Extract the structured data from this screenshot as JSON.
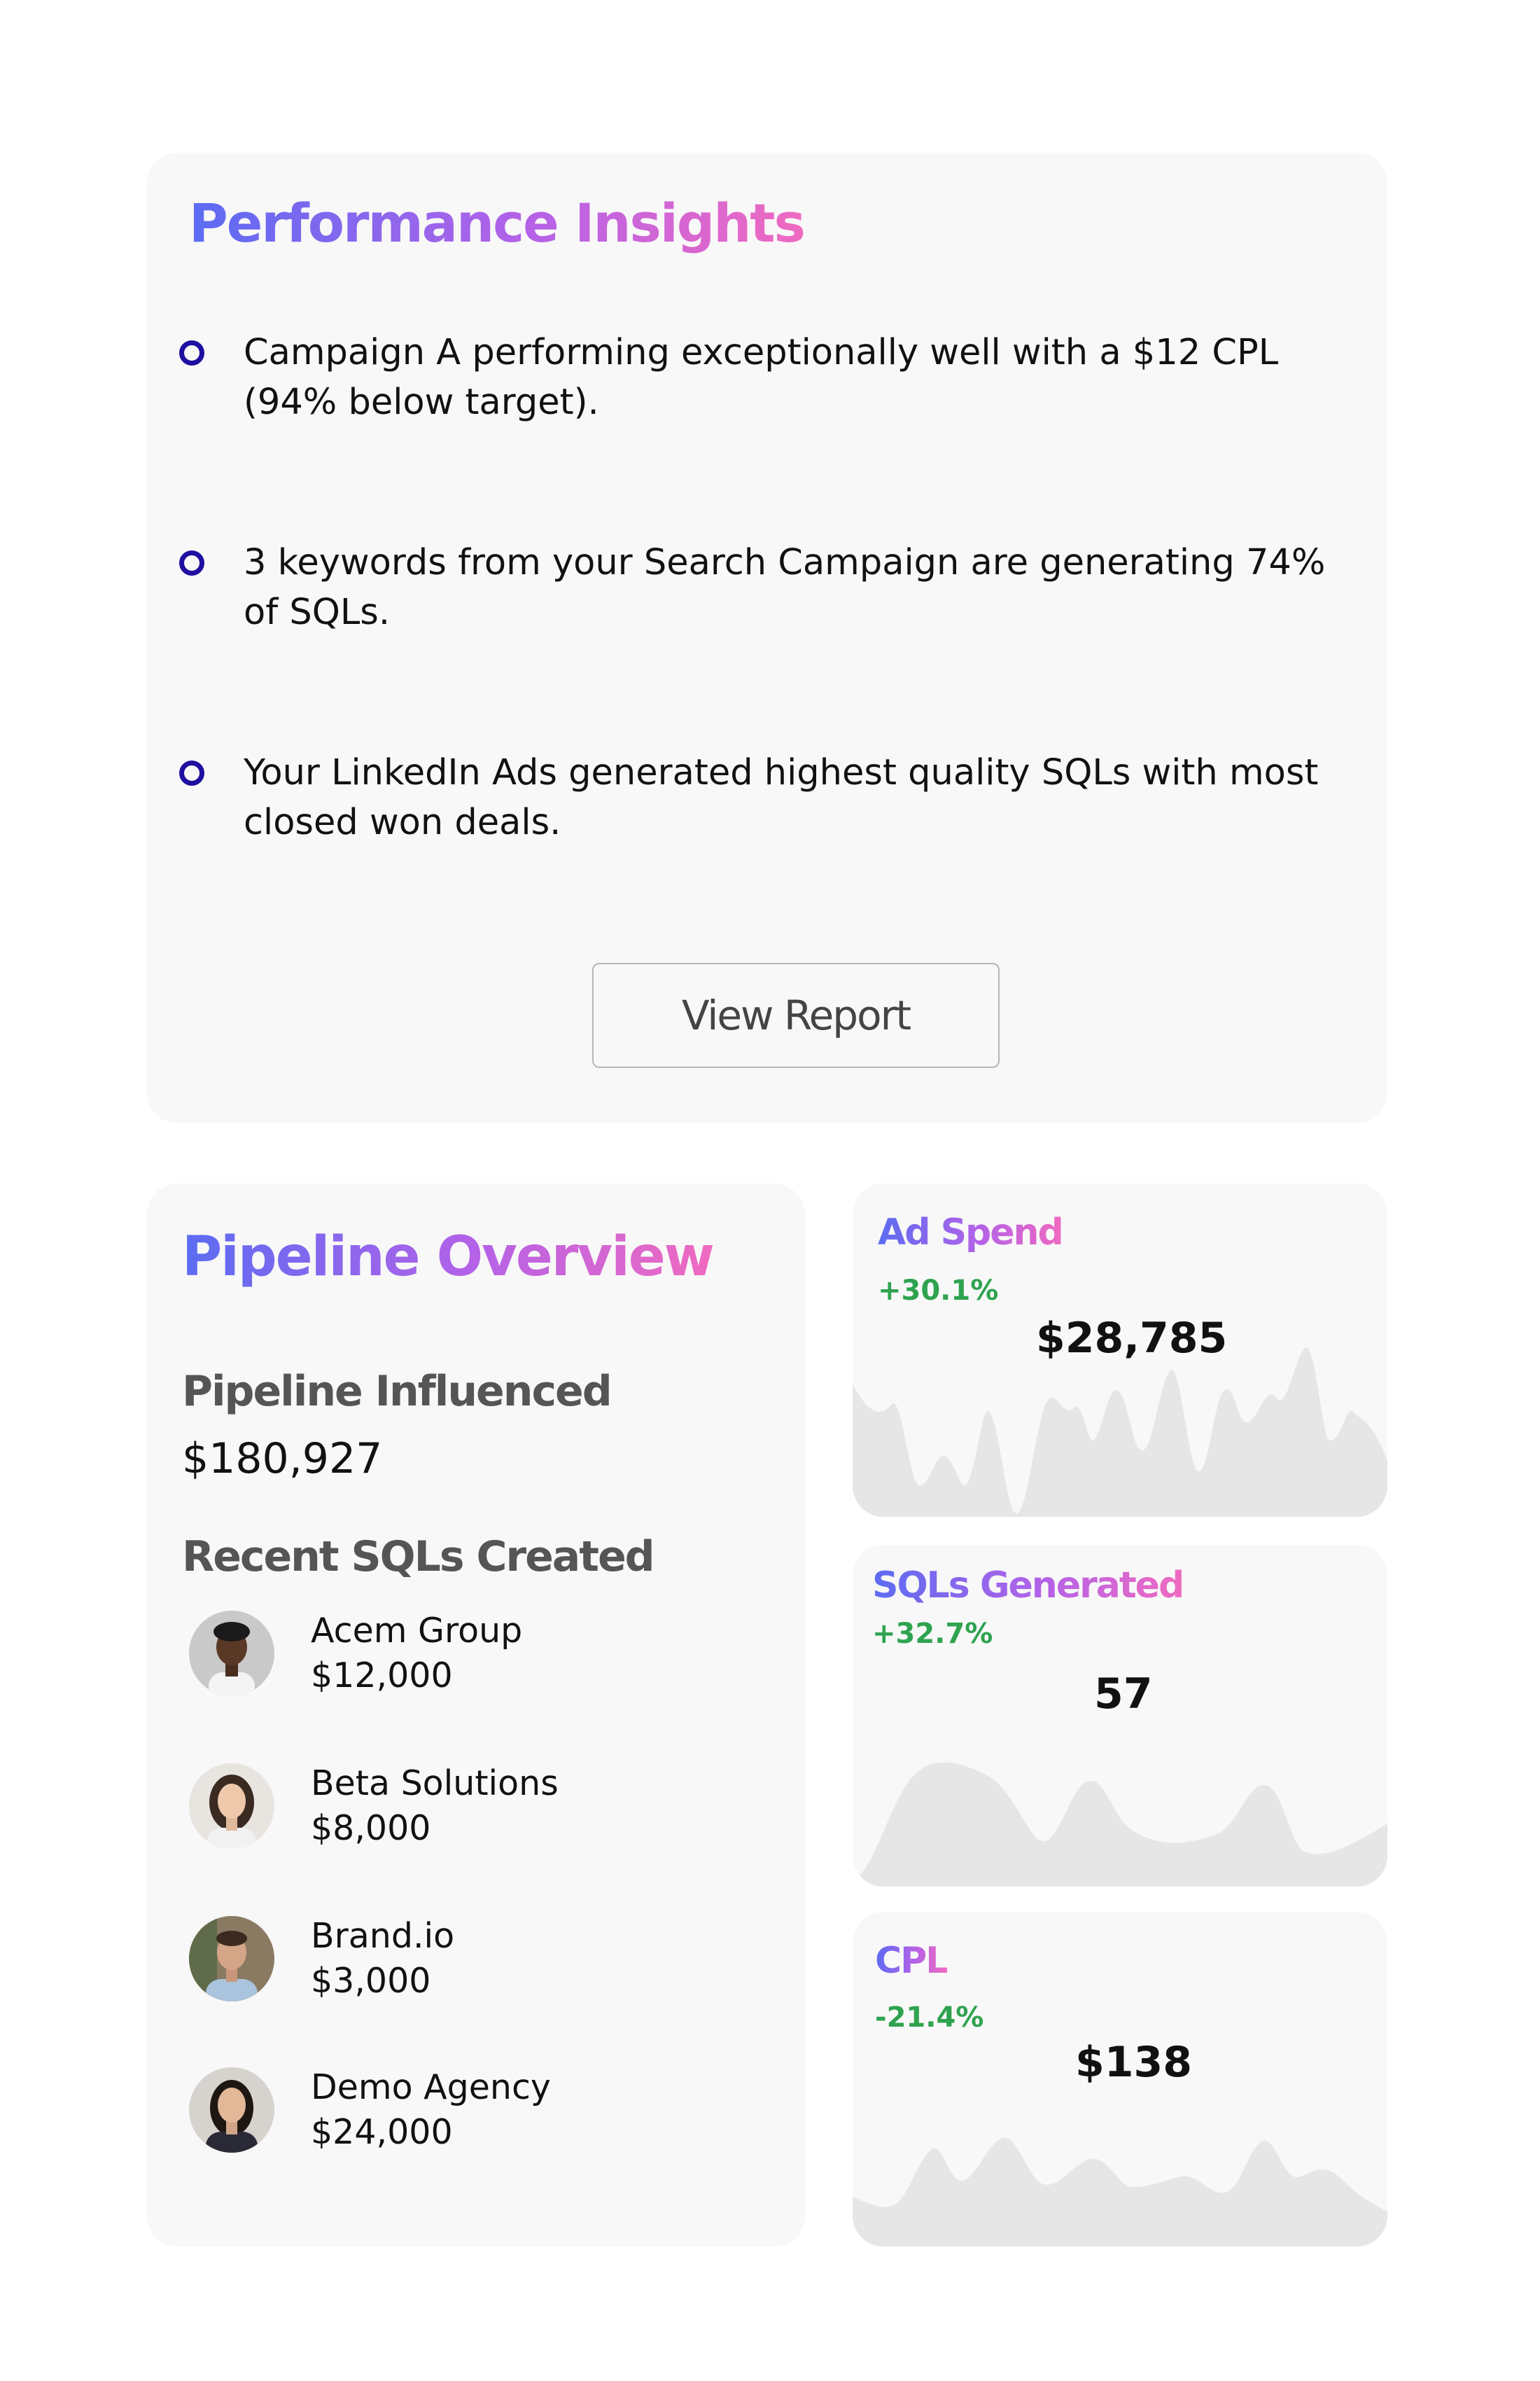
{
  "performance_insights": {
    "title": "Performance Insights",
    "items": [
      "Campaign A performing exceptionally well with a $12 CPL (94% below target).",
      "3 keywords from your Search Campaign are generating 74% of SQLs.",
      "Your LinkedIn Ads generated highest quality SQLs with most closed won deals."
    ],
    "button_label": "View Report"
  },
  "pipeline_overview": {
    "title": "Pipeline Overview",
    "influenced_label": "Pipeline Influenced",
    "influenced_value": "$180,927",
    "recent_label": "Recent SQLs Created",
    "recent": [
      {
        "name": "Acem Group",
        "amount": "$12,000",
        "avatar": "person-avatar"
      },
      {
        "name": "Beta Solutions",
        "amount": "$8,000",
        "avatar": "person-avatar"
      },
      {
        "name": "Brand.io",
        "amount": "$3,000",
        "avatar": "person-avatar"
      },
      {
        "name": "Demo Agency",
        "amount": "$24,000",
        "avatar": "person-avatar"
      }
    ]
  },
  "metrics": [
    {
      "title": "Ad Spend",
      "change": "+30.1%",
      "value": "$28,785",
      "change_color": "#2fa34f"
    },
    {
      "title": "SQLs Generated",
      "change": "+32.7%",
      "value": "57",
      "change_color": "#2fa34f"
    },
    {
      "title": "CPL",
      "change": "-21.4%",
      "value": "$138",
      "change_color": "#2fa34f"
    }
  ],
  "colors": {
    "card_background": "#f8f8f8",
    "title_gradient_start": "#5b6cf2",
    "title_gradient_end": "#f06ac0",
    "bullet_ring": "#1e0fa0",
    "positive": "#2fa34f",
    "sparkline_fill": "#e6e6e6"
  }
}
